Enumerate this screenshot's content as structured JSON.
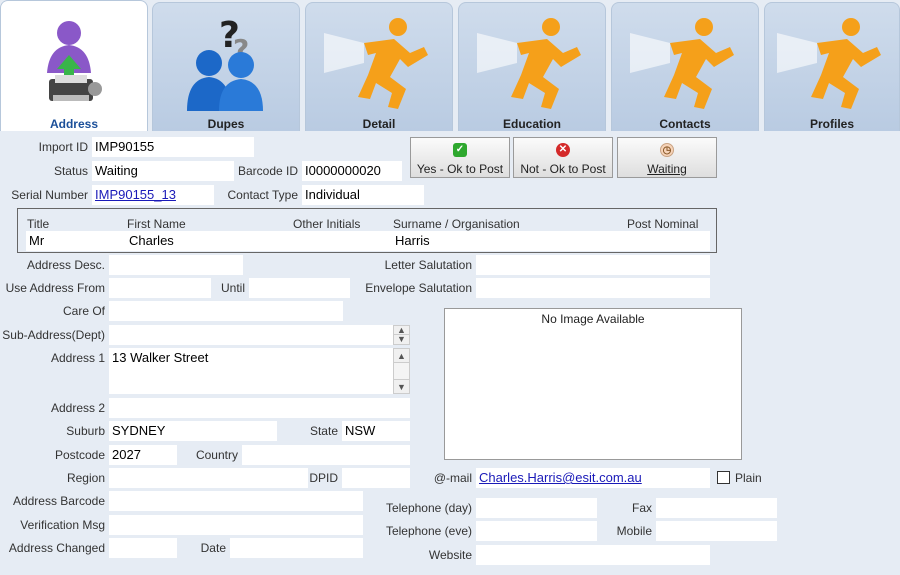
{
  "tabs": [
    {
      "label": "Address",
      "icon": "person-printer-icon"
    },
    {
      "label": "Dupes",
      "icon": "duplicate-people-icon"
    },
    {
      "label": "Detail",
      "icon": "running-man-icon"
    },
    {
      "label": "Education",
      "icon": "running-man-icon"
    },
    {
      "label": "Contacts",
      "icon": "running-man-icon"
    },
    {
      "label": "Profiles",
      "icon": "running-man-icon"
    }
  ],
  "form": {
    "import_id_label": "Import ID",
    "import_id": "IMP90155",
    "status_label": "Status",
    "status": "Waiting",
    "barcode_id_label": "Barcode ID",
    "barcode_id": "I0000000020",
    "serial_label": "Serial Number",
    "serial": "IMP90155_13",
    "contact_type_label": "Contact Type",
    "contact_type": "Individual",
    "title_label": "Title",
    "title": "Mr",
    "first_name_label": "First Name",
    "first_name": "Charles",
    "other_initials_label": "Other Initials",
    "other_initials": "",
    "surname_label": "Surname / Organisation",
    "surname": "Harris",
    "post_nominal_label": "Post Nominal",
    "post_nominal": "",
    "address_desc_label": "Address Desc.",
    "address_desc": "",
    "use_from_label": "Use Address From",
    "use_from": "",
    "until_label": "Until",
    "until": "",
    "care_of_label": "Care Of",
    "care_of": "",
    "sub_address_label": "Sub-Address(Dept)",
    "sub_address": "",
    "address1_label": "Address 1",
    "address1": "13 Walker Street",
    "address2_label": "Address 2",
    "address2": "",
    "suburb_label": "Suburb",
    "suburb": "SYDNEY",
    "state_label": "State",
    "state": "NSW",
    "postcode_label": "Postcode",
    "postcode": "2027",
    "country_label": "Country",
    "country": "",
    "region_label": "Region",
    "region": "",
    "dpid_label": "DPID",
    "dpid": "",
    "address_barcode_label": "Address Barcode",
    "address_barcode": "",
    "verification_label": "Verification Msg",
    "verification": "",
    "address_changed_label": "Address Changed",
    "address_changed": "",
    "date_label": "Date",
    "date": "",
    "letter_salutation_label": "Letter Salutation",
    "letter_salutation": "",
    "envelope_salutation_label": "Envelope Salutation",
    "envelope_salutation": "",
    "no_image": "No Image Available",
    "email_label": "@-mail",
    "email": "Charles.Harris@esit.com.au",
    "plain_label": "Plain",
    "tel_day_label": "Telephone (day)",
    "tel_day": "",
    "tel_eve_label": "Telephone (eve)",
    "tel_eve": "",
    "fax_label": "Fax",
    "fax": "",
    "mobile_label": "Mobile",
    "mobile": "",
    "website_label": "Website",
    "website": ""
  },
  "buttons": {
    "yes": "Yes - Ok to Post",
    "not": "Not - Ok to Post",
    "waiting": "Waiting",
    "yes_color": "#2ea82e",
    "not_color": "#d42a2a"
  }
}
